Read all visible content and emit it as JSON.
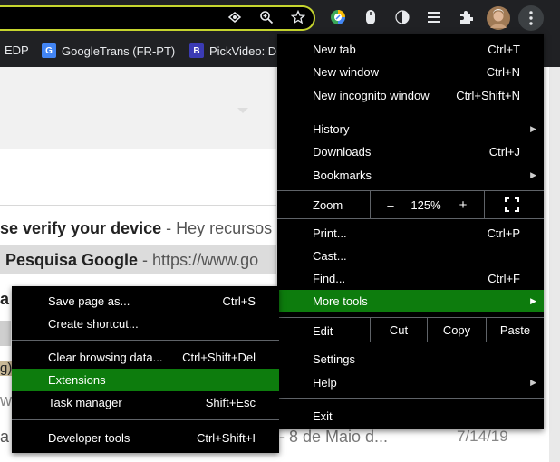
{
  "toolbar": {
    "icons": [
      "eye-icon",
      "zoom-icon",
      "star-icon",
      "extension-color-icon",
      "extension-mouse-icon",
      "contrast-icon",
      "reading-list-icon",
      "puzzle-icon",
      "avatar",
      "kebab-menu-icon"
    ]
  },
  "bookmarks": [
    {
      "label": "EDP"
    },
    {
      "label": "GoogleTrans (FR-PT)",
      "favicon": "G"
    },
    {
      "label": "PickVideo: D",
      "favicon": "B"
    }
  ],
  "background": {
    "line1_bold": "se verify your device",
    "line1_rest": " - Hey recursos",
    "line2_bold": "Pesquisa Google",
    "line2_rest": " - https://www.go",
    "partial_a": "a",
    "partial_g": "g)",
    "partial_www": "ww",
    "partial_a2": "a",
    "row_text": "- 8 de Maio d...",
    "row_date": "7/14/19"
  },
  "menu": {
    "new_tab": {
      "label": "New tab",
      "shortcut": "Ctrl+T"
    },
    "new_window": {
      "label": "New window",
      "shortcut": "Ctrl+N"
    },
    "new_incognito": {
      "label": "New incognito window",
      "shortcut": "Ctrl+Shift+N"
    },
    "history": {
      "label": "History"
    },
    "downloads": {
      "label": "Downloads",
      "shortcut": "Ctrl+J"
    },
    "bookmarks": {
      "label": "Bookmarks"
    },
    "zoom": {
      "label": "Zoom",
      "minus": "–",
      "value": "125%",
      "plus": "+",
      "fullscreen": "⛶"
    },
    "print": {
      "label": "Print...",
      "shortcut": "Ctrl+P"
    },
    "cast": {
      "label": "Cast..."
    },
    "find": {
      "label": "Find...",
      "shortcut": "Ctrl+F"
    },
    "more_tools": {
      "label": "More tools"
    },
    "edit": {
      "label": "Edit",
      "cut": "Cut",
      "copy": "Copy",
      "paste": "Paste"
    },
    "settings": {
      "label": "Settings"
    },
    "help": {
      "label": "Help"
    },
    "exit": {
      "label": "Exit"
    },
    "arrow": "▶"
  },
  "submenu": {
    "save_page": {
      "label": "Save page as...",
      "shortcut": "Ctrl+S"
    },
    "create_shortcut": {
      "label": "Create shortcut..."
    },
    "clear_browsing": {
      "label": "Clear browsing data...",
      "shortcut": "Ctrl+Shift+Del"
    },
    "extensions": {
      "label": "Extensions"
    },
    "task_manager": {
      "label": "Task manager",
      "shortcut": "Shift+Esc"
    },
    "developer_tools": {
      "label": "Developer tools",
      "shortcut": "Ctrl+Shift+I"
    }
  },
  "colors": {
    "highlight": "#0d7c0d",
    "menu_bg": "#000000",
    "toolbar_bg": "#202124",
    "omnibox_border": "#c6d52e"
  }
}
